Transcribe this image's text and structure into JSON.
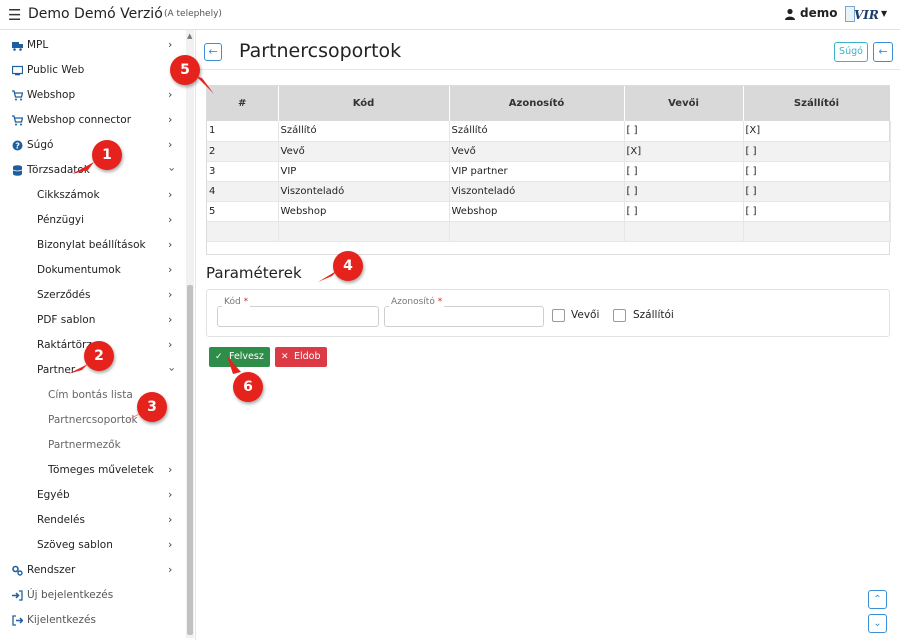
{
  "header": {
    "app_title": "Demo Demó Verzió",
    "app_subtitle": "(A telephely)",
    "user_name": "demo",
    "logo_text": "VIR",
    "colors": {
      "accent": "#3b8fd6",
      "help": "#3cb3c9"
    }
  },
  "sidebar": {
    "items": [
      {
        "label": "MPL",
        "icon": "truck-icon",
        "has_children": true
      },
      {
        "label": "Public Web",
        "icon": "monitor-icon",
        "has_children": false
      },
      {
        "label": "Webshop",
        "icon": "cart-icon",
        "has_children": true
      },
      {
        "label": "Webshop connector",
        "icon": "cart-icon",
        "has_children": true
      },
      {
        "label": "Súgó",
        "icon": "question-circle-icon",
        "has_children": true
      },
      {
        "label": "Törzsadatok",
        "icon": "database-icon",
        "has_children": true,
        "expanded": true
      },
      {
        "label": "Cikkszámok",
        "level": 2
      },
      {
        "label": "Pénzügyi",
        "level": 2
      },
      {
        "label": "Bizonylat beállítások",
        "level": 2
      },
      {
        "label": "Dokumentumok",
        "level": 2
      },
      {
        "label": "Szerződés",
        "level": 2
      },
      {
        "label": "PDF sablon",
        "level": 2
      },
      {
        "label": "Raktártörz",
        "level": 2
      },
      {
        "label": "Partner",
        "level": 2,
        "expanded": true
      },
      {
        "label": "Cím bontás lista",
        "level": 3
      },
      {
        "label": "Partnercsoportok",
        "level": 3
      },
      {
        "label": "Partnermezők",
        "level": 3
      },
      {
        "label": "Tömeges műveletek",
        "level": 3
      },
      {
        "label": "Egyéb",
        "level": 2
      },
      {
        "label": "Rendelés",
        "level": 2
      },
      {
        "label": "Szöveg sablon",
        "level": 2
      },
      {
        "label": "Rendszer",
        "icon": "cogs-icon"
      },
      {
        "label": "Új bejelentkezés",
        "icon": "sign-in-icon"
      },
      {
        "label": "Kijelentkezés",
        "icon": "sign-out-icon"
      }
    ]
  },
  "page": {
    "title": "Partnercsoportok",
    "help_label": "Súgó"
  },
  "table": {
    "columns": [
      "#",
      "Kód",
      "Azonosító",
      "Vevői",
      "Szállítói"
    ],
    "rows": [
      [
        "1",
        "Szállító",
        "Szállító",
        "[ ]",
        "[X]"
      ],
      [
        "2",
        "Vevő",
        "Vevő",
        "[X]",
        "[ ]"
      ],
      [
        "3",
        "VIP",
        "VIP partner",
        "[ ]",
        "[ ]"
      ],
      [
        "4",
        "Viszonteladó",
        "Viszonteladó",
        "[ ]",
        "[ ]"
      ],
      [
        "5",
        "Webshop",
        "Webshop",
        "[ ]",
        "[ ]"
      ]
    ]
  },
  "params": {
    "title": "Paraméterek",
    "kod_label": "Kód",
    "kod_value": "",
    "azon_label": "Azonosító",
    "azon_value": "",
    "required_mark": "*",
    "vevoi_label": "Vevői",
    "vevoi_checked": false,
    "szallitoi_label": "Szállítói",
    "szallitoi_checked": false
  },
  "actions": {
    "save_label": "Felvesz",
    "discard_label": "Eldob"
  },
  "callouts": [
    "1",
    "2",
    "3",
    "4",
    "5",
    "6"
  ]
}
